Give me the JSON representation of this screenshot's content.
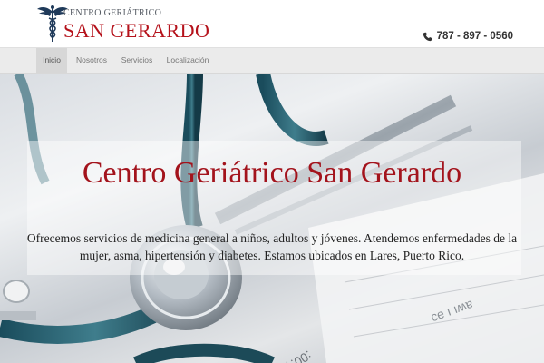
{
  "header": {
    "logo_top": "CENTRO GERIÁTRICO",
    "logo_bottom": "SAN GERARDO",
    "phone": "787 - 897 - 0560"
  },
  "nav": {
    "items": [
      "Inicio",
      "Nosotros",
      "Servicios",
      "Localización"
    ],
    "active_index": 0
  },
  "hero": {
    "title": "Centro Geriátrico San Gerardo",
    "text": "Ofrecemos servicios de medicina general a niños, adultos y jóvenes. Atendemos enfermedades de la mujer, asma, hipertensión y diabetes. Estamos ubicados en Lares, Puerto Rico."
  },
  "colors": {
    "brand_red": "#b5121b",
    "logo_navy": "#1f3a5a",
    "nav_bg": "#ebebeb",
    "nav_active": "#d7d7d7"
  },
  "icons": [
    "caduceus-icon",
    "phone-icon"
  ]
}
